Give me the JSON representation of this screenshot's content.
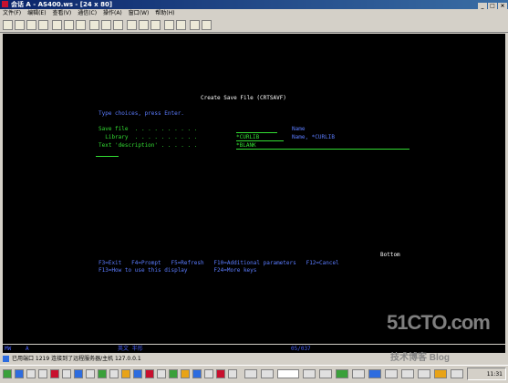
{
  "window": {
    "title": "会话 A - AS400.ws - [24 x 80]"
  },
  "menu": [
    "文件(F)",
    "编辑(E)",
    "查看(V)",
    "通信(C)",
    "操作(A)",
    "窗口(W)",
    "帮助(H)"
  ],
  "terminal": {
    "title": "Create Save File (CRTSAVF)",
    "instruction": "Type choices, press Enter.",
    "params": [
      {
        "label": "Save file  . . . . . . . . . .",
        "value": "",
        "hint": "Name"
      },
      {
        "label": "  Library  . . . . . . . . . .",
        "value": "*CURLIB",
        "hint": "Name, *CURLIB"
      },
      {
        "label": "Text 'description' . . . . . .",
        "value": "*BLANK",
        "hint": ""
      }
    ],
    "bottom_marker": "Bottom",
    "fkeys_line1": "F3=Exit   F4=Prompt   F5=Refresh   F10=Additional parameters   F12=Cancel",
    "fkeys_line2": "F13=How to use this display        F24=More keys"
  },
  "oia": {
    "mode": "MW",
    "session": "A",
    "ime": "英文 半形",
    "cursor": "05/037"
  },
  "status": {
    "text": "已用端口 1219 连接到了远程服务器/主机 127.0.0.1"
  },
  "taskbar": {
    "clock": "11:31"
  },
  "watermark": {
    "site": "51CTO.com",
    "blog": "技术博客  Blog"
  }
}
